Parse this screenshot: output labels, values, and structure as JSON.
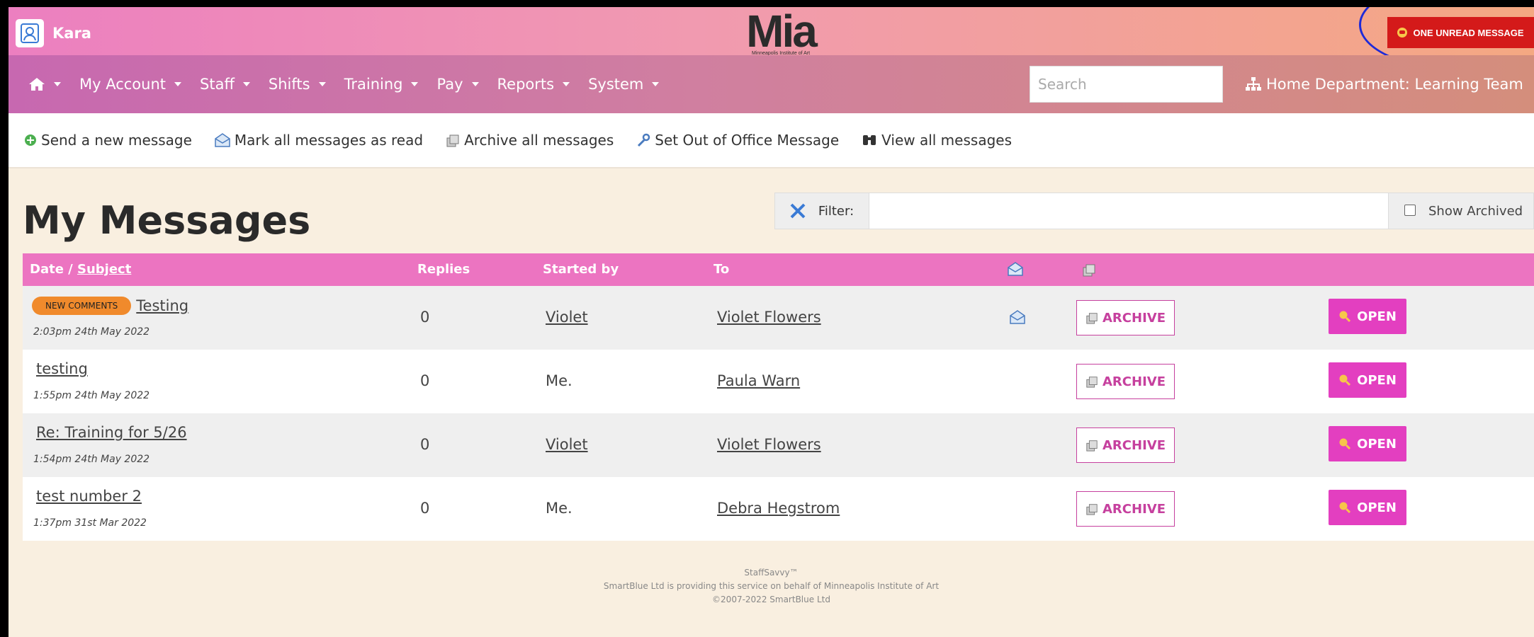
{
  "header": {
    "user_name": "Kara",
    "logo_text": "Mia",
    "logo_subtitle": "Minneapolis Institute of Art",
    "unread_label": "ONE UNREAD MESSAGE"
  },
  "nav": {
    "items": [
      "My Account",
      "Staff",
      "Shifts",
      "Training",
      "Pay",
      "Reports",
      "System"
    ],
    "search_placeholder": "Search",
    "department": "Home Department: Learning Team"
  },
  "actions": {
    "send": "Send a new message",
    "mark_read": "Mark all messages as read",
    "archive_all": "Archive all messages",
    "out_of_office": "Set Out of Office Message",
    "view_all": "View all messages"
  },
  "page": {
    "title": "My Messages",
    "filter_label": "Filter:",
    "show_archived": "Show Archived"
  },
  "table": {
    "headers": {
      "date": "Date / ",
      "subject": "Subject",
      "replies": "Replies",
      "started_by": "Started by",
      "to": "To"
    },
    "rows": [
      {
        "badge": "NEW COMMENTS",
        "subject": "Testing",
        "date": "2:03pm 24th May 2022",
        "replies": "0",
        "started_by": "Violet",
        "to": "Violet Flowers",
        "archive": "ARCHIVE",
        "open": "OPEN"
      },
      {
        "badge": "",
        "subject": "testing",
        "date": "1:55pm 24th May 2022",
        "replies": "0",
        "started_by": "Me.",
        "to": "Paula Warn",
        "archive": "ARCHIVE",
        "open": "OPEN"
      },
      {
        "badge": "",
        "subject": "Re: Training for 5/26",
        "date": "1:54pm 24th May 2022",
        "replies": "0",
        "started_by": "Violet",
        "to": "Violet Flowers",
        "archive": "ARCHIVE",
        "open": "OPEN"
      },
      {
        "badge": "",
        "subject": "test number 2",
        "date": "1:37pm 31st Mar 2022",
        "replies": "0",
        "started_by": "Me.",
        "to": "Debra Hegstrom",
        "archive": "ARCHIVE",
        "open": "OPEN"
      }
    ]
  },
  "footer": {
    "line1": "StaffSavvy™",
    "line2": "SmartBlue Ltd is providing this service on behalf of Minneapolis Institute of Art",
    "line3": "©2007-2022 SmartBlue Ltd"
  },
  "colors": {
    "accent": "#ec74c1",
    "button": "#e33fc0",
    "badge": "#f08a2c",
    "alert": "#d41a1a"
  }
}
